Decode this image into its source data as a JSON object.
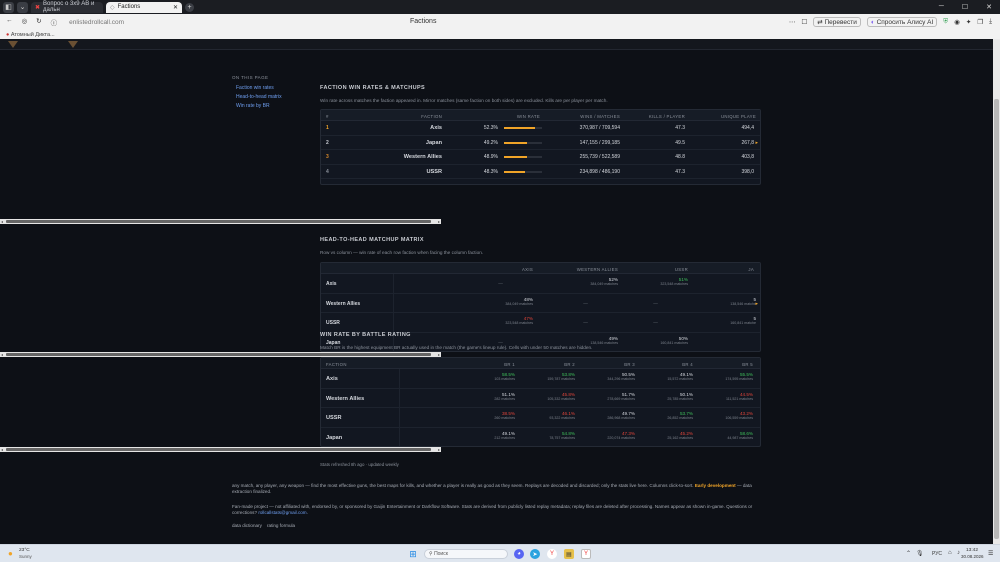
{
  "browser": {
    "tabs": [
      {
        "label": "Вопрос о 3x9 АВ и дальн",
        "active": false
      },
      {
        "label": "Factions",
        "active": true
      }
    ],
    "url": "enlistedrollcall.com",
    "page_title": "Factions",
    "translate_label": "Перевести",
    "alice_label": "Спросить Алису AI",
    "bookmark": "Атомный Дикта..."
  },
  "toc": {
    "heading": "ON THIS PAGE",
    "links": [
      "Faction win rates",
      "Head-to-head matrix",
      "Win rate by BR"
    ]
  },
  "section1": {
    "title": "FACTION WIN RATES & MATCHUPS",
    "desc": "Win rate across matches the faction appeared in. Mirror matches (same faction on both sides) are excluded. Kills are per player per match.",
    "headers": [
      "#",
      "FACTION",
      "WIN RATE",
      "WINS / MATCHES",
      "KILLS / PLAYER",
      "UNIQUE PLAYE"
    ],
    "rows": [
      {
        "rank": "1",
        "faction": "Axis",
        "winrate": "52.3%",
        "wr_value": 52.3,
        "wins": "370,987 / 709,594",
        "kills": "47.3",
        "unique": "494,4"
      },
      {
        "rank": "2",
        "faction": "Japan",
        "winrate": "49.2%",
        "wr_value": 49.2,
        "wins": "147,155 / 299,185",
        "kills": "49.5",
        "unique": "267,8"
      },
      {
        "rank": "3",
        "faction": "Western Allies",
        "winrate": "48.9%",
        "wr_value": 48.9,
        "wins": "255,739 / 522,589",
        "kills": "48.8",
        "unique": "403,8"
      },
      {
        "rank": "4",
        "faction": "USSR",
        "winrate": "48.3%",
        "wr_value": 48.3,
        "wins": "234,898 / 486,190",
        "kills": "47.3",
        "unique": "398,0"
      }
    ]
  },
  "section2": {
    "title": "HEAD-TO-HEAD MATCHUP MATRIX",
    "desc": "Row vs column — win rate of each row faction when facing the column faction.",
    "headers": [
      "AXIS",
      "WESTERN ALLIES",
      "USSR",
      "JA"
    ],
    "rows": [
      {
        "faction": "Axis",
        "cells": [
          {
            "v": "—",
            "s": "",
            "c": "dash"
          },
          {
            "v": "52%",
            "s": "384,049 matches",
            "c": "white"
          },
          {
            "v": "51%",
            "s": "323,548 matches",
            "c": "green"
          },
          {
            "v": "",
            "s": "",
            "c": "white"
          }
        ]
      },
      {
        "faction": "Western Allies",
        "cells": [
          {
            "v": "48%",
            "s": "384,049 matches",
            "c": "white"
          },
          {
            "v": "—",
            "s": "",
            "c": "dash"
          },
          {
            "v": "—",
            "s": "",
            "c": "dash"
          },
          {
            "v": "5",
            "s": "138,546 matche",
            "c": "white"
          }
        ]
      },
      {
        "faction": "USSR",
        "cells": [
          {
            "v": "47%",
            "s": "323,548 matches",
            "c": "red"
          },
          {
            "v": "—",
            "s": "",
            "c": "dash"
          },
          {
            "v": "—",
            "s": "",
            "c": "dash"
          },
          {
            "v": "5",
            "s": "160,841 matche",
            "c": "white"
          }
        ]
      },
      {
        "faction": "Japan",
        "cells": [
          {
            "v": "—",
            "s": "",
            "c": "dash"
          },
          {
            "v": "49%",
            "s": "138,546 matches",
            "c": "white"
          },
          {
            "v": "50%",
            "s": "160,841 matches",
            "c": "white"
          },
          {
            "v": "",
            "s": "",
            "c": "white"
          }
        ]
      }
    ]
  },
  "section3": {
    "title": "WIN RATE BY BATTLE RATING",
    "desc": "Match BR is the highest equipment BR actually used in the match (the game's lineup rule). Cells with under 50 matches are hidden.",
    "headers": [
      "FACTION",
      "BR 1",
      "BR 2",
      "BR 3",
      "BR 4",
      "BR 5"
    ],
    "rows": [
      {
        "faction": "Axis",
        "cells": [
          {
            "v": "58.5%",
            "s": "103 matches",
            "c": "green"
          },
          {
            "v": "53.8%",
            "s": "159,787 matches",
            "c": "green"
          },
          {
            "v": "50.5%",
            "s": "344,296 matches",
            "c": "white"
          },
          {
            "v": "49.1%",
            "s": "15,572 matches",
            "c": "white"
          },
          {
            "v": "55.5%",
            "s": "174,595 matches",
            "c": "green"
          }
        ]
      },
      {
        "faction": "Western Allies",
        "cells": [
          {
            "v": "51.1%",
            "s": "282 matches",
            "c": "white"
          },
          {
            "v": "45.8%",
            "s": "105,332 matches",
            "c": "red"
          },
          {
            "v": "51.7%",
            "s": "278,669 matches",
            "c": "white"
          },
          {
            "v": "50.1%",
            "s": "25,785 matches",
            "c": "white"
          },
          {
            "v": "44.5%",
            "s": "111,521 matches",
            "c": "red"
          }
        ]
      },
      {
        "faction": "USSR",
        "cells": [
          {
            "v": "38.5%",
            "s": "260 matches",
            "c": "red"
          },
          {
            "v": "46.1%",
            "s": "93,322 matches",
            "c": "red"
          },
          {
            "v": "49.7%",
            "s": "286,968 matches",
            "c": "white"
          },
          {
            "v": "53.7%",
            "s": "26,852 matches",
            "c": "green"
          },
          {
            "v": "43.2%",
            "s": "106,559 matches",
            "c": "red"
          }
        ]
      },
      {
        "faction": "Japan",
        "cells": [
          {
            "v": "49.1%",
            "s": "212 matches",
            "c": "white"
          },
          {
            "v": "54.8%",
            "s": "78,757 matches",
            "c": "green"
          },
          {
            "v": "47.3%",
            "s": "220,074 matches",
            "c": "red"
          },
          {
            "v": "45.2%",
            "s": "25,162 matches",
            "c": "red"
          },
          {
            "v": "58.6%",
            "s": "44,987 matches",
            "c": "green"
          }
        ]
      }
    ],
    "refresh": "Stats refreshed 8h ago · updated weekly"
  },
  "footer": {
    "p1_a": "any match, any player, any weapon — find the most effective guns, the best maps for kills, and whether a player is really as good as they seem. Replays are decoded and discarded; only the stats live here. Columns click-to-sort. ",
    "p1_dev": "Early development",
    "p1_b": " — data extraction finalized.",
    "p2": "Fan-made project — not affiliated with, endorsed by, or sponsored by Gaijin Entertainment or Darkflow Software. Stats are derived from publicly listed replay metadata; replay files are deleted after processing. Names appear as shown in-game. Questions or corrections? ",
    "p2_link": "rollcallstats@gmail.com",
    "p2_end": ".",
    "links": [
      "data dictionary",
      "rating formula"
    ]
  },
  "taskbar": {
    "temp": "23°C",
    "weather": "Sunny",
    "search": "Поиск",
    "lang": "РУС",
    "time": "13:42",
    "date": "30.08.2026"
  },
  "colors": {
    "accent": "#f0a428",
    "good": "#3fbf5a",
    "bad": "#e0453a",
    "link": "#6f9ff0"
  }
}
